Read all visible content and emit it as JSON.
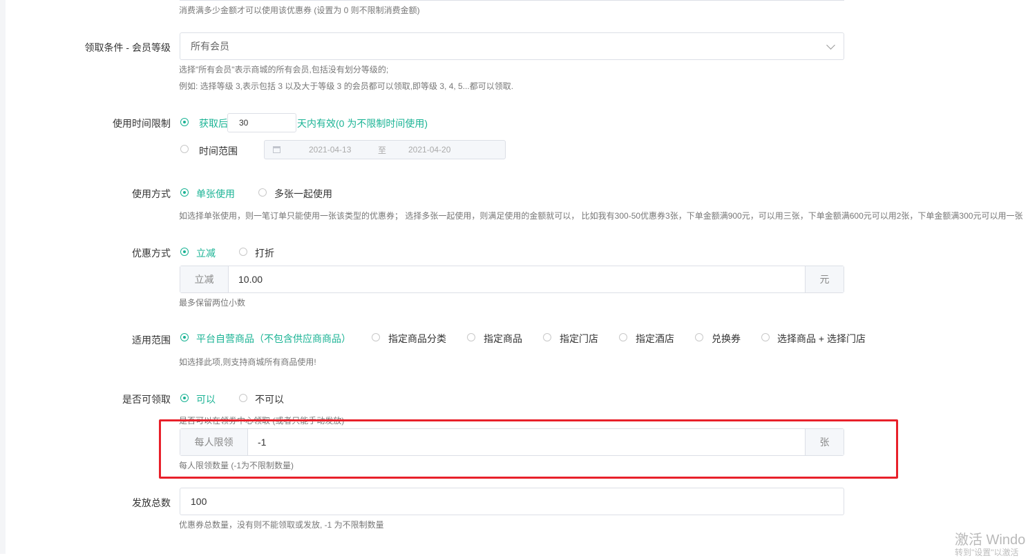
{
  "min_spend_hint": "消费满多少金额才可以使用该优惠券 (设置为 0 则不限制消费金额)",
  "member_level": {
    "label": "领取条件 - 会员等级",
    "selected": "所有会员",
    "hint1": "选择\"所有会员\"表示商城的所有会员,包括没有划分等级的;",
    "hint2": "例如: 选择等级 3,表示包括 3 以及大于等级 3 的会员都可以领取,即等级 3, 4, 5...都可以领取."
  },
  "time_limit": {
    "label": "使用时间限制",
    "option1_prefix": "获取后",
    "days_value": "30",
    "option1_suffix": "天内有效(0 为不限制时间使用)",
    "option2": "时间范围",
    "date_start": "2021-04-13",
    "date_sep": "至",
    "date_end": "2021-04-20"
  },
  "usage_mode": {
    "label": "使用方式",
    "option1": "单张使用",
    "option2": "多张一起使用",
    "hint": "如选择单张使用，则一笔订单只能使用一张该类型的优惠券； 选择多张一起使用，则满足使用的金额就可以， 比如我有300-50优惠券3张，下单金额满900元，可以用三张，下单金额满600元可以用2张，下单金额满300元可以用一张"
  },
  "discount_mode": {
    "label": "优惠方式",
    "option1": "立减",
    "option2": "打折",
    "prefix": "立减",
    "value": "10.00",
    "suffix": "元",
    "hint": "最多保留两位小数"
  },
  "scope": {
    "label": "适用范围",
    "options": [
      "平台自营商品（不包含供应商商品）",
      "指定商品分类",
      "指定商品",
      "指定门店",
      "指定酒店",
      "兑换券",
      "选择商品 + 选择门店"
    ],
    "hint": "如选择此项,则支持商城所有商品使用!"
  },
  "claimable": {
    "label": "是否可领取",
    "option1": "可以",
    "option2": "不可以",
    "hint": "是否可以在领券中心领取 (或者只能手动发放)"
  },
  "per_person": {
    "prefix": "每人限领",
    "value": "-1",
    "suffix": "张",
    "hint": "每人限领数量 (-1为不限制数量)"
  },
  "total": {
    "label": "发放总数",
    "value": "100",
    "hint": "优惠券总数量，没有则不能领取或发放, -1 为不限制数量"
  },
  "watermark": {
    "line1": "激活 Windo",
    "line2": "转到\"设置\"以激活"
  },
  "colors": {
    "accent": "#1ab394",
    "highlight_frame": "#e8202a"
  }
}
